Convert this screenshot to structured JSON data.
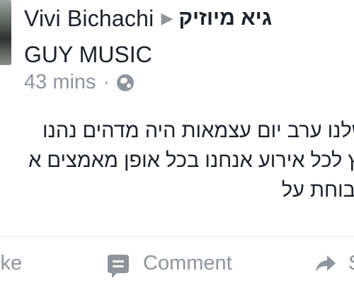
{
  "post_header": {
    "author": "Vivi Bichachi",
    "separator_icon": "triangle-right-icon",
    "page_name": "גיא מיוזיק",
    "page_name_en": "GUY MUSIC",
    "timestamp": "43 mins",
    "separator": "·",
    "privacy_icon": "globe-icon"
  },
  "post_body": {
    "lines": [
      "שלנו ערב יום עצמאות היה מדהים נהנו",
      "ץ לכל אירוע אנחנו בכל אופן מאמצים א",
      "בוחת  על"
    ]
  },
  "actions": {
    "like_label": "Like",
    "like_visible": "ike",
    "comment_label": "Comment",
    "share_visible": "S"
  }
}
